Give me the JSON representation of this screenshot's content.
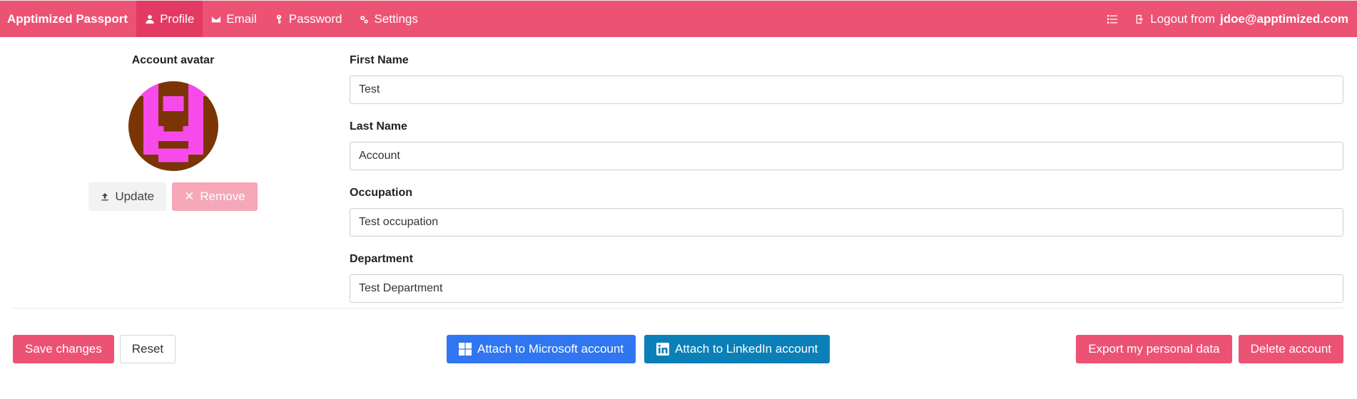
{
  "navbar": {
    "brand": "Apptimized Passport",
    "tabs": [
      {
        "label": "Profile",
        "icon": "person-icon"
      },
      {
        "label": "Email",
        "icon": "envelope-icon"
      },
      {
        "label": "Password",
        "icon": "key-icon"
      },
      {
        "label": "Settings",
        "icon": "gears-icon"
      }
    ],
    "logout_prefix": "Logout from",
    "logout_user": "jdoe@apptimized.com"
  },
  "avatar": {
    "title": "Account avatar",
    "update_label": "Update",
    "remove_label": "Remove",
    "colors": {
      "primary": "#f64bea",
      "secondary": "#7b3505"
    }
  },
  "form": {
    "first_name": {
      "label": "First Name",
      "value": "Test"
    },
    "last_name": {
      "label": "Last Name",
      "value": "Account"
    },
    "occupation": {
      "label": "Occupation",
      "value": "Test occupation"
    },
    "department": {
      "label": "Department",
      "value": "Test Department"
    }
  },
  "actions": {
    "save": "Save changes",
    "reset": "Reset",
    "attach_microsoft": "Attach to Microsoft account",
    "attach_linkedin": "Attach to LinkedIn account",
    "export": "Export my personal data",
    "delete": "Delete account"
  },
  "colors": {
    "brand": "#ec5274",
    "brand_active": "#e23a62",
    "microsoft": "#2f76f0",
    "linkedin": "#0b7fb7"
  }
}
